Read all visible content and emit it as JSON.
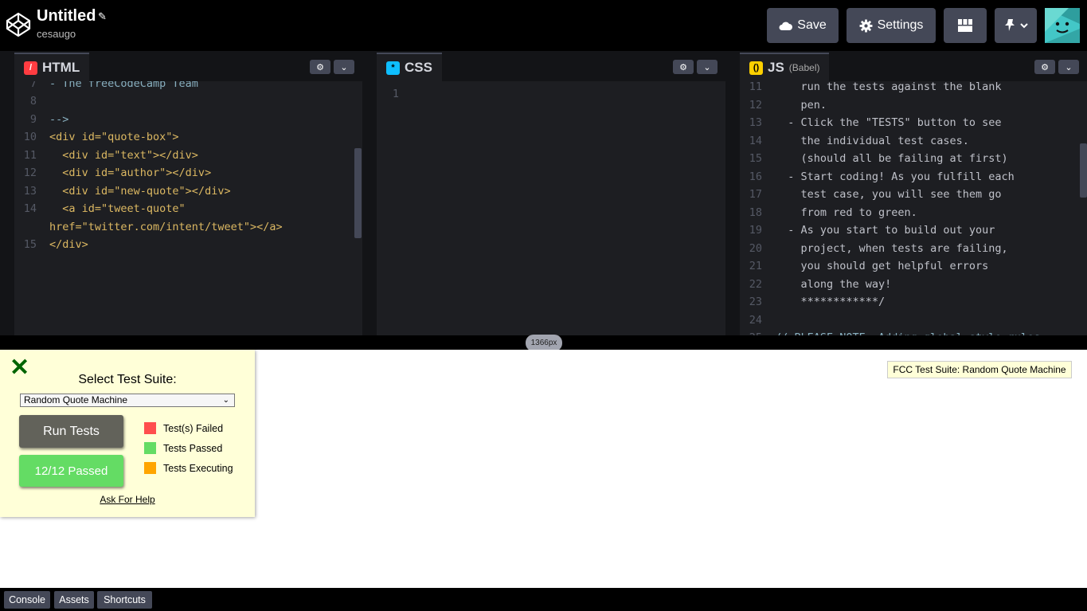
{
  "header": {
    "title": "Untitled",
    "owner": "cesaugo",
    "save_label": "Save",
    "settings_label": "Settings",
    "icons": [
      "codepen-logo-icon",
      "pencil-icon",
      "cloud-icon",
      "gear-icon",
      "layout-icon",
      "pin-icon",
      "chevron-down-icon"
    ]
  },
  "panes": {
    "html": {
      "label": "HTML",
      "accent": "#ff3c41"
    },
    "css": {
      "label": "CSS",
      "accent": "#0ebeff"
    },
    "js": {
      "label": "JS",
      "sub": "(Babel)",
      "accent": "#fcd000"
    }
  },
  "html_code": {
    "lines": [
      {
        "n": "7",
        "text": "- The freeCodeCamp Team"
      },
      {
        "n": "8",
        "text": ""
      },
      {
        "n": "9",
        "text": "-->"
      },
      {
        "n": "10",
        "text": "<div id=\"quote-box\">"
      },
      {
        "n": "11",
        "text": "  <div id=\"text\"></div>"
      },
      {
        "n": "12",
        "text": "  <div id=\"author\"></div>"
      },
      {
        "n": "13",
        "text": "  <div id=\"new-quote\"></div>"
      },
      {
        "n": "14",
        "text": "  <a id=\"tweet-quote\""
      },
      {
        "n": "",
        "text": "href=\"twitter.com/intent/tweet\"></a>"
      },
      {
        "n": "15",
        "text": "</div>"
      }
    ]
  },
  "css_code": {
    "lines": [
      {
        "n": "1",
        "text": ""
      }
    ]
  },
  "js_code": {
    "lines": [
      {
        "n": "11",
        "text": "    run the tests against the blank"
      },
      {
        "n": "12",
        "text": "    pen."
      },
      {
        "n": "13",
        "text": "  - Click the \"TESTS\" button to see"
      },
      {
        "n": "14",
        "text": "    the individual test cases."
      },
      {
        "n": "15",
        "text": "    (should all be failing at first)"
      },
      {
        "n": "16",
        "text": "  - Start coding! As you fulfill each"
      },
      {
        "n": "17",
        "text": "    test case, you will see them go"
      },
      {
        "n": "18",
        "text": "    from red to green."
      },
      {
        "n": "19",
        "text": "  - As you start to build out your"
      },
      {
        "n": "20",
        "text": "    project, when tests are failing,"
      },
      {
        "n": "21",
        "text": "    you should get helpful errors"
      },
      {
        "n": "22",
        "text": "    along the way!"
      },
      {
        "n": "23",
        "text": "    ************/"
      },
      {
        "n": "24",
        "text": ""
      },
      {
        "n": "25",
        "text": "// PLEASE NOTE: Adding global style rules"
      }
    ]
  },
  "preview_width_label": "1366px",
  "fcc": {
    "close": "✕",
    "select_label": "Select Test Suite:",
    "selected_suite": "Random Quote Machine",
    "run_label": "Run Tests",
    "result_label": "12/12 Passed",
    "legend": [
      {
        "label": "Test(s) Failed",
        "color": "#ff4e4e"
      },
      {
        "label": "Tests Passed",
        "color": "#64dc64"
      },
      {
        "label": "Tests Executing",
        "color": "#ffa500"
      }
    ],
    "help_label": "Ask For Help",
    "tooltip": "FCC Test Suite: Random Quote Machine"
  },
  "footer": {
    "console": "Console",
    "assets": "Assets",
    "shortcuts": "Shortcuts"
  }
}
